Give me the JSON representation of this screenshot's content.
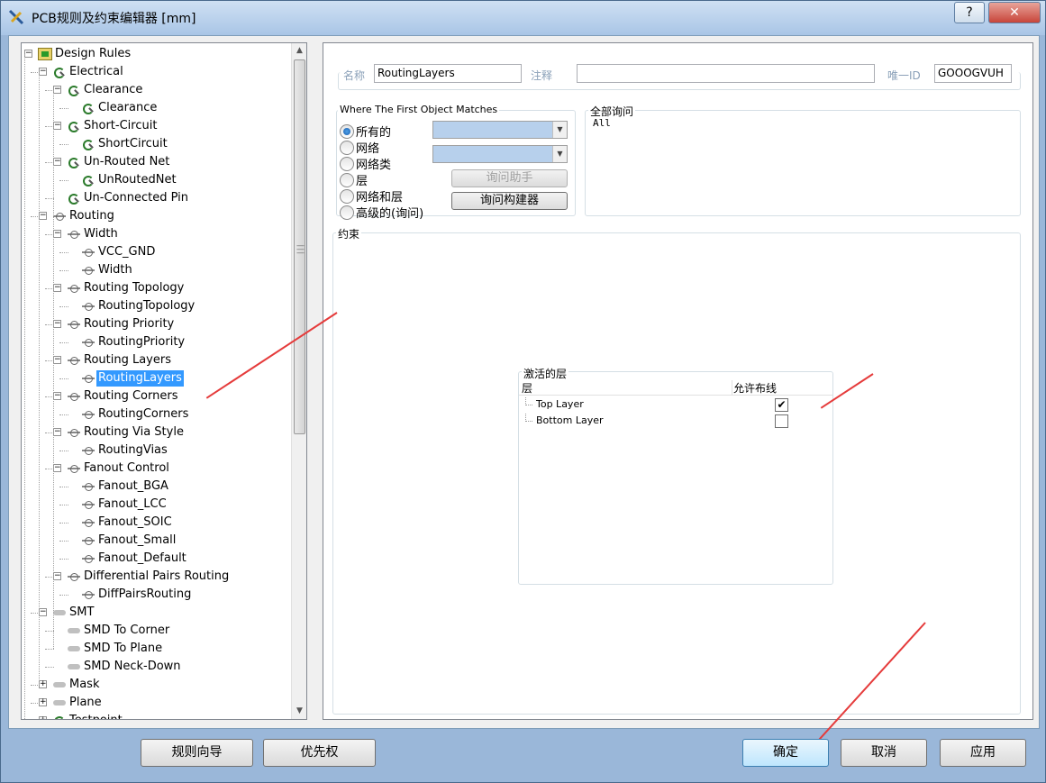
{
  "window": {
    "title": "PCB规则及约束编辑器 [mm]",
    "help_label": "?",
    "close_label": "✕"
  },
  "tree": {
    "nodes": [
      {
        "label": "Design Rules",
        "level": 0,
        "icon": "root",
        "expander": "−"
      },
      {
        "label": "Electrical",
        "level": 1,
        "icon": "rule",
        "expander": "−"
      },
      {
        "label": "Clearance",
        "level": 2,
        "icon": "rule",
        "expander": "−"
      },
      {
        "label": "Clearance",
        "level": 3,
        "icon": "rule",
        "expander": ""
      },
      {
        "label": "Short-Circuit",
        "level": 2,
        "icon": "rule",
        "expander": "−"
      },
      {
        "label": "ShortCircuit",
        "level": 3,
        "icon": "rule",
        "expander": ""
      },
      {
        "label": "Un-Routed Net",
        "level": 2,
        "icon": "rule",
        "expander": "−"
      },
      {
        "label": "UnRoutedNet",
        "level": 3,
        "icon": "rule",
        "expander": ""
      },
      {
        "label": "Un-Connected Pin",
        "level": 2,
        "icon": "rule",
        "expander": ""
      },
      {
        "label": "Routing",
        "level": 1,
        "icon": "route",
        "expander": "−"
      },
      {
        "label": "Width",
        "level": 2,
        "icon": "route",
        "expander": "−"
      },
      {
        "label": "VCC_GND",
        "level": 3,
        "icon": "route",
        "expander": ""
      },
      {
        "label": "Width",
        "level": 3,
        "icon": "route",
        "expander": ""
      },
      {
        "label": "Routing Topology",
        "level": 2,
        "icon": "route",
        "expander": "−"
      },
      {
        "label": "RoutingTopology",
        "level": 3,
        "icon": "route",
        "expander": ""
      },
      {
        "label": "Routing Priority",
        "level": 2,
        "icon": "route",
        "expander": "−"
      },
      {
        "label": "RoutingPriority",
        "level": 3,
        "icon": "route",
        "expander": ""
      },
      {
        "label": "Routing Layers",
        "level": 2,
        "icon": "route",
        "expander": "−"
      },
      {
        "label": "RoutingLayers",
        "level": 3,
        "icon": "route",
        "expander": "",
        "selected": true
      },
      {
        "label": "Routing Corners",
        "level": 2,
        "icon": "route",
        "expander": "−"
      },
      {
        "label": "RoutingCorners",
        "level": 3,
        "icon": "route",
        "expander": ""
      },
      {
        "label": "Routing Via Style",
        "level": 2,
        "icon": "route",
        "expander": "−"
      },
      {
        "label": "RoutingVias",
        "level": 3,
        "icon": "route",
        "expander": ""
      },
      {
        "label": "Fanout Control",
        "level": 2,
        "icon": "route",
        "expander": "−"
      },
      {
        "label": "Fanout_BGA",
        "level": 3,
        "icon": "route",
        "expander": ""
      },
      {
        "label": "Fanout_LCC",
        "level": 3,
        "icon": "route",
        "expander": ""
      },
      {
        "label": "Fanout_SOIC",
        "level": 3,
        "icon": "route",
        "expander": ""
      },
      {
        "label": "Fanout_Small",
        "level": 3,
        "icon": "route",
        "expander": ""
      },
      {
        "label": "Fanout_Default",
        "level": 3,
        "icon": "route",
        "expander": ""
      },
      {
        "label": "Differential Pairs Routing",
        "level": 2,
        "icon": "route",
        "expander": "−"
      },
      {
        "label": "DiffPairsRouting",
        "level": 3,
        "icon": "route",
        "expander": ""
      },
      {
        "label": "SMT",
        "level": 1,
        "icon": "smt",
        "expander": "−"
      },
      {
        "label": "SMD To Corner",
        "level": 2,
        "icon": "smt",
        "expander": ""
      },
      {
        "label": "SMD To Plane",
        "level": 2,
        "icon": "smt",
        "expander": ""
      },
      {
        "label": "SMD Neck-Down",
        "level": 2,
        "icon": "smt",
        "expander": ""
      },
      {
        "label": "Mask",
        "level": 1,
        "icon": "smt",
        "expander": "+"
      },
      {
        "label": "Plane",
        "level": 1,
        "icon": "smt",
        "expander": "+"
      },
      {
        "label": "Testpoint",
        "level": 1,
        "icon": "rule",
        "expander": "+"
      }
    ]
  },
  "rule_header": {
    "name_label": "名称",
    "name_value": "RoutingLayers",
    "comment_label": "注释",
    "comment_value": "",
    "uid_label": "唯一ID",
    "uid_value": "GOOOGVUH"
  },
  "match": {
    "title": "Where The First Object Matches",
    "options": [
      "所有的",
      "网络",
      "网络类",
      "层",
      "网络和层",
      "高级的(询问)"
    ],
    "query_helper": "询问助手",
    "query_builder": "询问构建器"
  },
  "full_query": {
    "title": "全部询问",
    "text": "All"
  },
  "constraints": {
    "title": "约束"
  },
  "layers": {
    "title": "激活的层",
    "col_layer": "层",
    "col_allow": "允许布线",
    "rows": [
      {
        "name": "Top Layer",
        "checked": true,
        "check_glyph": "✔"
      },
      {
        "name": "Bottom Layer",
        "checked": false,
        "check_glyph": ""
      }
    ]
  },
  "footer": {
    "rule_wizard": "规则向导",
    "priorities": "优先权",
    "ok": "确定",
    "cancel": "取消",
    "apply": "应用"
  },
  "colors": {
    "selection": "#3399ff",
    "annotation_arrow": "#e53b3b"
  }
}
